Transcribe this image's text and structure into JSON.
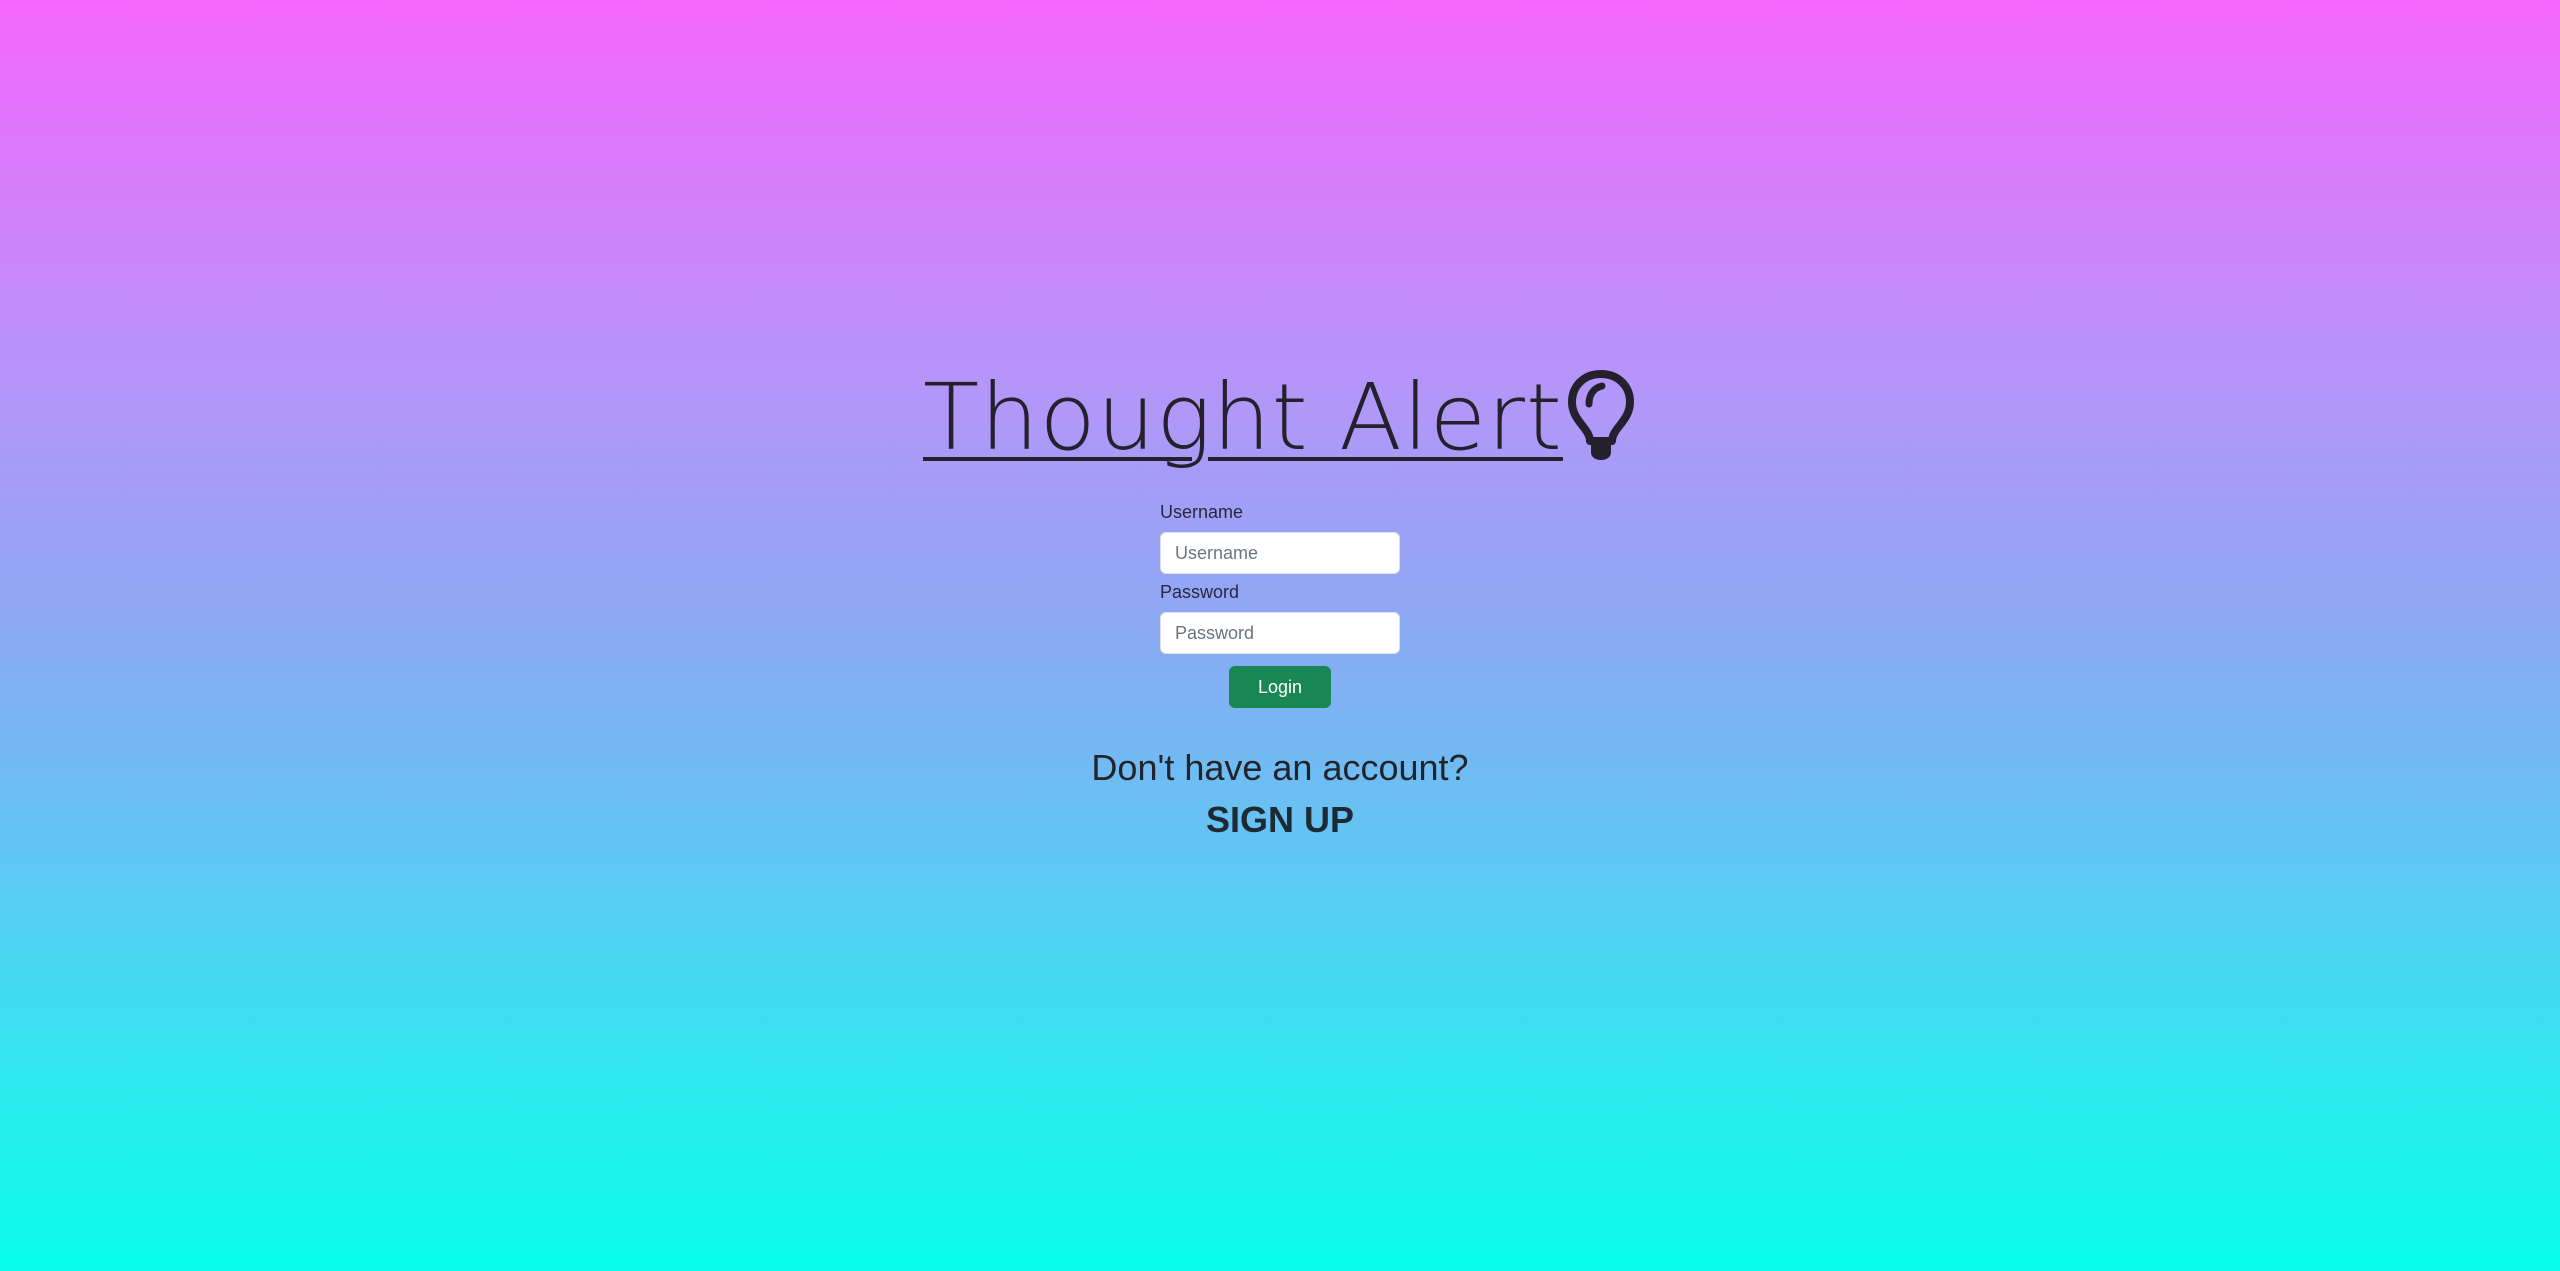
{
  "header": {
    "title": "Thought Alert",
    "icon": "lightbulb-icon"
  },
  "login_form": {
    "username_label": "Username",
    "username_placeholder": "Username",
    "username_value": "",
    "password_label": "Password",
    "password_placeholder": "Password",
    "password_value": "",
    "login_button_label": "Login"
  },
  "signup": {
    "prompt": "Don't have an account?",
    "link_label": "SIGN UP"
  },
  "colors": {
    "gradient_top": "#f466fd",
    "gradient_bottom": "#08fdeb",
    "login_button": "#198754",
    "text": "#212529"
  }
}
